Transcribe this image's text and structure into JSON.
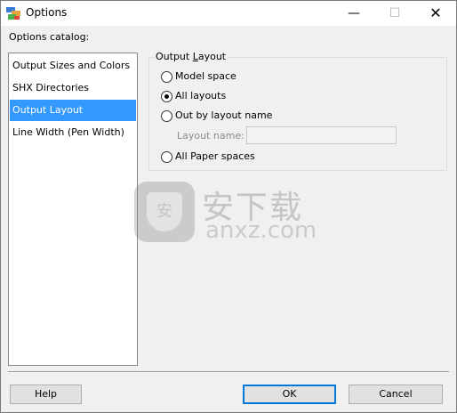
{
  "window": {
    "title": "Options",
    "minimize_glyph": "—",
    "maximize_glyph": "☐",
    "close_glyph": "✕"
  },
  "catalog": {
    "label": "Options catalog:",
    "items": [
      {
        "label": "Output Sizes and Colors",
        "selected": false
      },
      {
        "label": "SHX Directories",
        "selected": false
      },
      {
        "label": "Output Layout",
        "selected": true
      },
      {
        "label": "Line Width (Pen Width)",
        "selected": false
      }
    ]
  },
  "output_layout": {
    "legend_prefix": "Output ",
    "legend_accel": "L",
    "legend_suffix": "ayout",
    "options": [
      {
        "label": "Model space",
        "checked": false
      },
      {
        "label": "All layouts",
        "checked": true
      },
      {
        "label": "Out by layout name",
        "checked": false
      },
      {
        "label": "All Paper spaces",
        "checked": false
      }
    ],
    "layout_name_label": "Layout name:",
    "layout_name_value": ""
  },
  "watermark": {
    "chinese": "安下载",
    "latin": "anxz.com",
    "shield_char": "安"
  },
  "buttons": {
    "help": "Help",
    "ok": "OK",
    "cancel": "Cancel"
  },
  "colors": {
    "selection": "#3399ff",
    "default_button_border": "#0078d7"
  }
}
